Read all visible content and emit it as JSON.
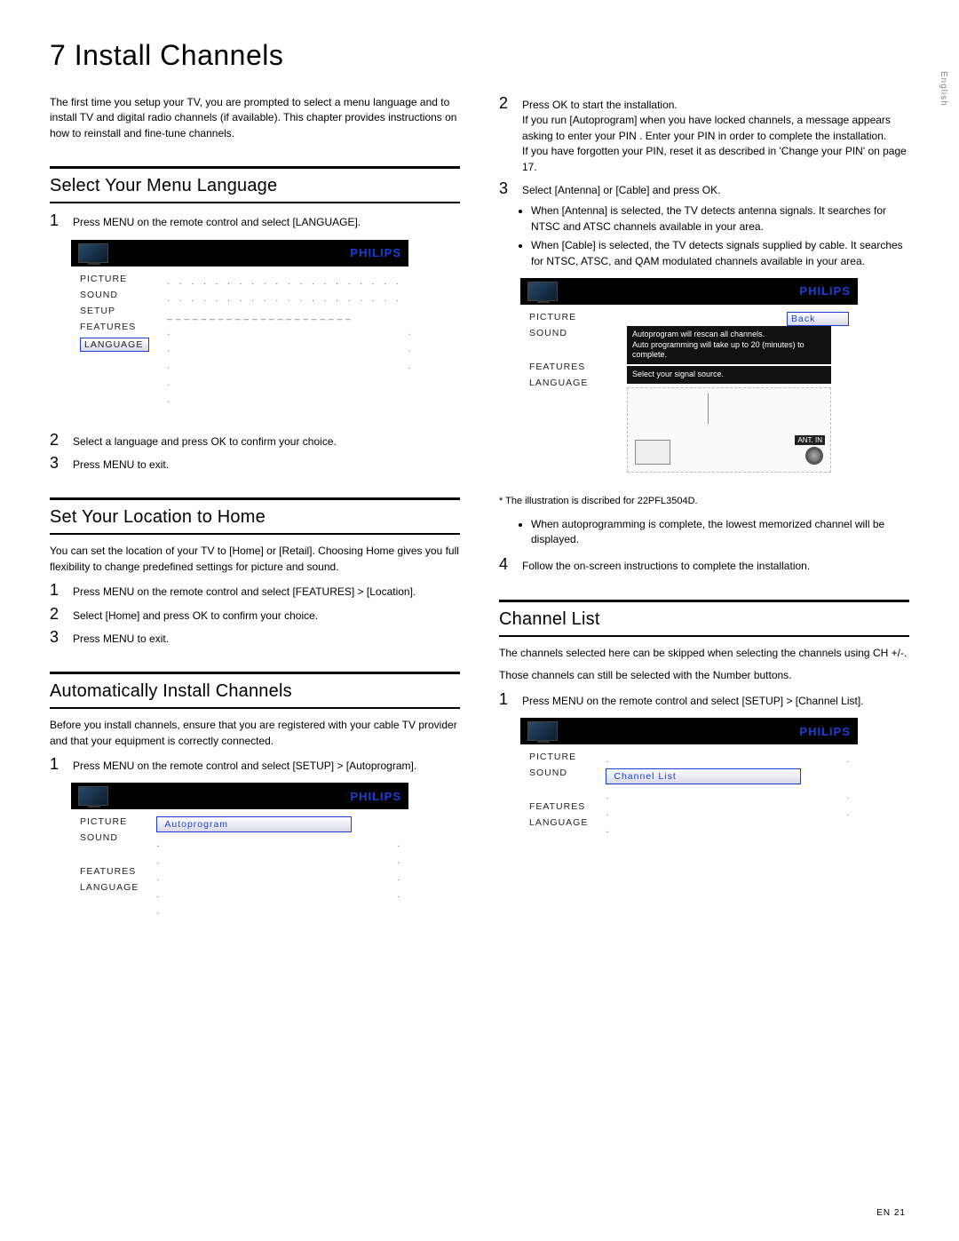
{
  "lang_tab": "English",
  "page_title": "7   Install Channels",
  "intro": "The first time you setup your TV, you are prompted to select a menu language and to install TV and digital radio channels (if available). This chapter provides instructions on how to reinstall and fine-tune channels.",
  "brand": "PHILIPS",
  "menu_items": {
    "picture": "PICTURE",
    "sound": "SOUND",
    "setup": "SETUP",
    "features": "FEATURES",
    "language": "LANGUAGE"
  },
  "sec_lang": {
    "heading": "Select Your Menu Language",
    "step1": "Press MENU on the remote control and select [LANGUAGE].",
    "step2": "Select a language and press OK to confirm your choice.",
    "step3": "Press MENU to exit."
  },
  "sec_loc": {
    "heading": "Set Your Location to Home",
    "p1": "You can set the location of your TV to [Home] or [Retail]. Choosing Home gives you full flexibility to change predefined settings for picture and sound.",
    "step1": "Press MENU on the remote control and select [FEATURES] > [Location].",
    "step2": "Select [Home] and press OK to confirm your choice.",
    "step3": "Press MENU to exit."
  },
  "sec_auto": {
    "heading": "Automatically Install Channels",
    "p1": "Before you install channels, ensure that you are registered with your cable TV provider and that your equipment is correctly connected.",
    "step1": "Press MENU on the remote control and select [SETUP] > [Autoprogram].",
    "sel_label": "Autoprogram"
  },
  "right_top": {
    "step2": "Press OK to start the installation.",
    "p_pin": "If you run [Autoprogram] when you have locked channels, a message appears asking to enter your PIN . Enter your PIN in order to complete the installation.",
    "p_forgot": "If you have forgotten your PIN, reset it as described in 'Change your PIN' on page 17.",
    "step3": "Select [Antenna] or [Cable] and press OK.",
    "b1": "When [Antenna] is selected, the TV detects antenna signals.  It searches for NTSC and ATSC channels available in your area.",
    "b2": "When [Cable] is selected, the TV detects signals supplied by cable.  It searches for NTSC, ATSC, and QAM modulated channels available in your area.",
    "back_label": "Back",
    "tip1": "Autoprogram will rescan all channels.",
    "tip2": "Auto programming will take up to 20 (minutes) to complete.",
    "tip3": "Select your signal source.",
    "ant_in": "ANT. IN",
    "caption": "* The illustration is discribed for 22PFL3504D.",
    "b3": "When autoprogramming is complete, the lowest memorized channel will be displayed.",
    "step4": "Follow the on-screen instructions to complete the installation."
  },
  "sec_chlist": {
    "heading": "Channel List",
    "p1": "The channels selected here can be skipped when selecting the channels using CH +/-.",
    "p2": "Those channels can still be selected with the Number buttons.",
    "step1": "Press MENU on the remote control and select [SETUP] > [Channel List].",
    "sel_label": "Channel List"
  },
  "footer": "EN     21"
}
